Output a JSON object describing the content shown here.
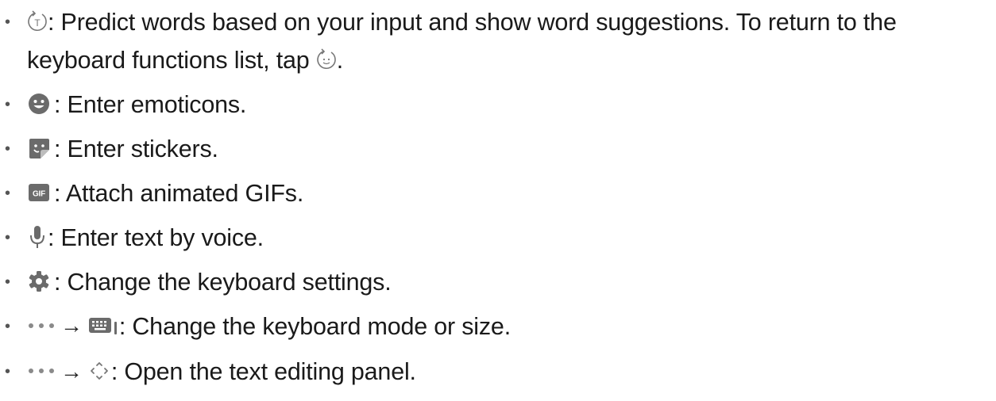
{
  "items": [
    {
      "icon": "predictive-text-icon",
      "text": ": Predict words based on your input and show word suggestions. To return to the keyboard functions list, tap",
      "trailing_icon": "emoji-toggle-icon",
      "trailing_text": "."
    },
    {
      "icon": "emoticon-icon",
      "text": ": Enter emoticons."
    },
    {
      "icon": "sticker-icon",
      "text": ": Enter stickers."
    },
    {
      "icon": "gif-icon",
      "icon_label": "GIF",
      "text": ": Attach animated GIFs."
    },
    {
      "icon": "microphone-icon",
      "text": ": Enter text by voice."
    },
    {
      "icon": "gear-icon",
      "text": ": Change the keyboard settings."
    },
    {
      "icon": "more-options-icon",
      "arrow": "→",
      "icon2": "keyboard-mode-icon",
      "text": ": Change the keyboard mode or size."
    },
    {
      "icon": "more-options-icon",
      "arrow": "→",
      "icon2": "text-editing-icon",
      "text": ": Open the text editing panel."
    }
  ]
}
